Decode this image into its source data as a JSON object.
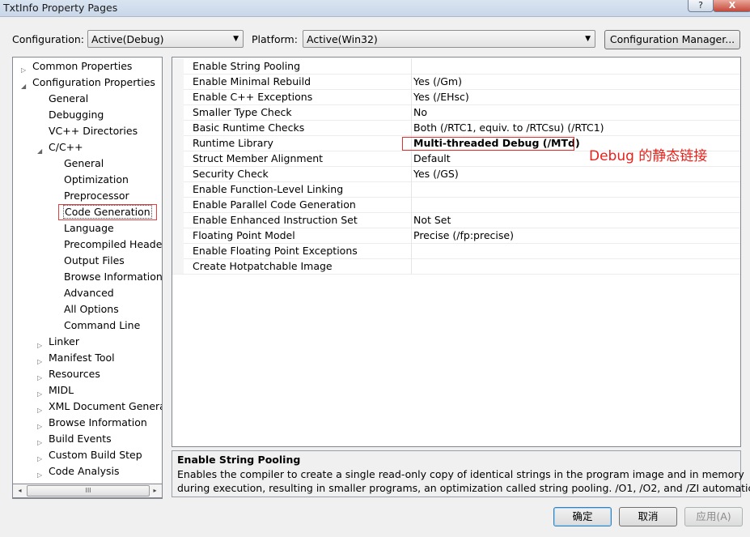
{
  "window": {
    "title": "TxtInfo Property Pages",
    "help_glyph": "?",
    "close_glyph": "X"
  },
  "toolbar": {
    "configuration_label": "Configuration:",
    "configuration_value": "Active(Debug)",
    "platform_label": "Platform:",
    "platform_value": "Active(Win32)",
    "config_manager_button": "Configuration Manager..."
  },
  "tree": [
    {
      "label": "Common Properties",
      "level": 0,
      "expander": "collapsed"
    },
    {
      "label": "Configuration Properties",
      "level": 0,
      "expander": "expanded"
    },
    {
      "label": "General",
      "level": 1,
      "expander": "none"
    },
    {
      "label": "Debugging",
      "level": 1,
      "expander": "none"
    },
    {
      "label": "VC++ Directories",
      "level": 1,
      "expander": "none"
    },
    {
      "label": "C/C++",
      "level": 1,
      "expander": "expanded"
    },
    {
      "label": "General",
      "level": 2,
      "expander": "none"
    },
    {
      "label": "Optimization",
      "level": 2,
      "expander": "none"
    },
    {
      "label": "Preprocessor",
      "level": 2,
      "expander": "none"
    },
    {
      "label": "Code Generation",
      "level": 2,
      "expander": "none",
      "selected": true
    },
    {
      "label": "Language",
      "level": 2,
      "expander": "none"
    },
    {
      "label": "Precompiled Header",
      "level": 2,
      "expander": "none"
    },
    {
      "label": "Output Files",
      "level": 2,
      "expander": "none"
    },
    {
      "label": "Browse Information",
      "level": 2,
      "expander": "none"
    },
    {
      "label": "Advanced",
      "level": 2,
      "expander": "none"
    },
    {
      "label": "All Options",
      "level": 2,
      "expander": "none"
    },
    {
      "label": "Command Line",
      "level": 2,
      "expander": "none"
    },
    {
      "label": "Linker",
      "level": 1,
      "expander": "collapsed"
    },
    {
      "label": "Manifest Tool",
      "level": 1,
      "expander": "collapsed"
    },
    {
      "label": "Resources",
      "level": 1,
      "expander": "collapsed"
    },
    {
      "label": "MIDL",
      "level": 1,
      "expander": "collapsed"
    },
    {
      "label": "XML Document Generat",
      "level": 1,
      "expander": "collapsed"
    },
    {
      "label": "Browse Information",
      "level": 1,
      "expander": "collapsed"
    },
    {
      "label": "Build Events",
      "level": 1,
      "expander": "collapsed"
    },
    {
      "label": "Custom Build Step",
      "level": 1,
      "expander": "collapsed"
    },
    {
      "label": "Code Analysis",
      "level": 1,
      "expander": "collapsed"
    }
  ],
  "scrollbar": {
    "left_arrow": "◂",
    "right_arrow": "▸",
    "grip": "III"
  },
  "properties": [
    {
      "name": "Enable String Pooling",
      "value": ""
    },
    {
      "name": "Enable Minimal Rebuild",
      "value": "Yes (/Gm)"
    },
    {
      "name": "Enable C++ Exceptions",
      "value": "Yes (/EHsc)"
    },
    {
      "name": "Smaller Type Check",
      "value": "No"
    },
    {
      "name": "Basic Runtime Checks",
      "value": "Both (/RTC1, equiv. to /RTCsu) (/RTC1)"
    },
    {
      "name": "Runtime Library",
      "value": "Multi-threaded Debug (/MTd)",
      "bold": true
    },
    {
      "name": "Struct Member Alignment",
      "value": "Default"
    },
    {
      "name": "Security Check",
      "value": "Yes (/GS)"
    },
    {
      "name": "Enable Function-Level Linking",
      "value": ""
    },
    {
      "name": "Enable Parallel Code Generation",
      "value": ""
    },
    {
      "name": "Enable Enhanced Instruction Set",
      "value": "Not Set"
    },
    {
      "name": "Floating Point Model",
      "value": "Precise (/fp:precise)"
    },
    {
      "name": "Enable Floating Point Exceptions",
      "value": ""
    },
    {
      "name": "Create Hotpatchable Image",
      "value": ""
    }
  ],
  "annotation": {
    "text": "Debug 的静态链接",
    "color": "#e8201a"
  },
  "description": {
    "title": "Enable String Pooling",
    "line1": "Enables the compiler to create a single read-only copy of identical strings in the program image and in memory",
    "line2": "during execution, resulting in smaller programs, an optimization called string pooling. /O1, /O2, and /ZI  automatical..."
  },
  "buttons": {
    "ok": "确定",
    "cancel": "取消",
    "apply": "应用(A)"
  }
}
